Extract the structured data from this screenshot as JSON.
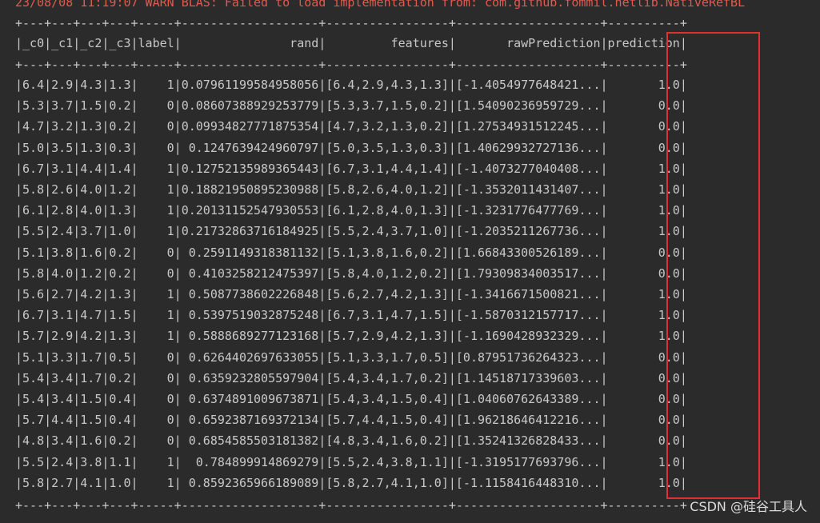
{
  "console": {
    "warn_line": "23/08/08 11:19:07 WARN BLAS: Failed to load implementation from: com.github.fommil.netlib.NativeRefBL",
    "separator": "+---+---+---+---+-----+-------------------+-----------------+--------------------+----------+",
    "header": "|_c0|_c1|_c2|_c3|label|               rand|         features|       rawPrediction|prediction|",
    "rows": [
      "|6.4|2.9|4.3|1.3|    1|0.07961199584958056|[6.4,2.9,4.3,1.3]|[-1.4054977648421...|       1.0|",
      "|5.3|3.7|1.5|0.2|    0|0.08607388929253779|[5.3,3.7,1.5,0.2]|[1.54090236959729...|       0.0|",
      "|4.7|3.2|1.3|0.2|    0|0.09934827771875354|[4.7,3.2,1.3,0.2]|[1.27534931512245...|       0.0|",
      "|5.0|3.5|1.3|0.3|    0| 0.1247639424960797|[5.0,3.5,1.3,0.3]|[1.40629932727136...|       0.0|",
      "|6.7|3.1|4.4|1.4|    1|0.12752135989365443|[6.7,3.1,4.4,1.4]|[-1.4073277040408...|       1.0|",
      "|5.8|2.6|4.0|1.2|    1|0.18821950895230988|[5.8,2.6,4.0,1.2]|[-1.3532011431407...|       1.0|",
      "|6.1|2.8|4.0|1.3|    1|0.20131152547930553|[6.1,2.8,4.0,1.3]|[-1.3231776477769...|       1.0|",
      "|5.5|2.4|3.7|1.0|    1|0.21732863716184925|[5.5,2.4,3.7,1.0]|[-1.2035211267736...|       1.0|",
      "|5.1|3.8|1.6|0.2|    0| 0.2591149318381132|[5.1,3.8,1.6,0.2]|[1.66843300526189...|       0.0|",
      "|5.8|4.0|1.2|0.2|    0| 0.4103258212475397|[5.8,4.0,1.2,0.2]|[1.79309834003517...|       0.0|",
      "|5.6|2.7|4.2|1.3|    1| 0.5087738602226848|[5.6,2.7,4.2,1.3]|[-1.3416671500821...|       1.0|",
      "|6.7|3.1|4.7|1.5|    1| 0.5397519032875248|[6.7,3.1,4.7,1.5]|[-1.5870312157717...|       1.0|",
      "|5.7|2.9|4.2|1.3|    1| 0.5888689277123168|[5.7,2.9,4.2,1.3]|[-1.1690428932329...|       1.0|",
      "|5.1|3.3|1.7|0.5|    0| 0.6264402697633055|[5.1,3.3,1.7,0.5]|[0.87951736264323...|       0.0|",
      "|5.4|3.4|1.7|0.2|    0| 0.6359232805597904|[5.4,3.4,1.7,0.2]|[1.14518717339603...|       0.0|",
      "|5.4|3.4|1.5|0.4|    0| 0.6374891009673871|[5.4,3.4,1.5,0.4]|[1.04060762643389...|       0.0|",
      "|5.7|4.4|1.5|0.4|    0| 0.6592387169372134|[5.7,4.4,1.5,0.4]|[1.96218646412216...|       0.0|",
      "|4.8|3.4|1.6|0.2|    0| 0.6854585503181382|[4.8,3.4,1.6,0.2]|[1.35241326828433...|       0.0|",
      "|5.5|2.4|3.8|1.1|    1|  0.784899914869279|[5.5,2.4,3.8,1.1]|[-1.3195177693796...|       1.0|",
      "|5.8|2.7|4.1|1.0|    1| 0.8592365966189089|[5.8,2.7,4.1,1.0]|[-1.1158416448310...|       1.0|"
    ]
  },
  "watermark": "CSDN @硅谷工具人",
  "colors": {
    "background": "#2b2b2b",
    "text": "#c8c8c8",
    "warn": "#e05a4e",
    "highlight_border": "#e03131"
  }
}
